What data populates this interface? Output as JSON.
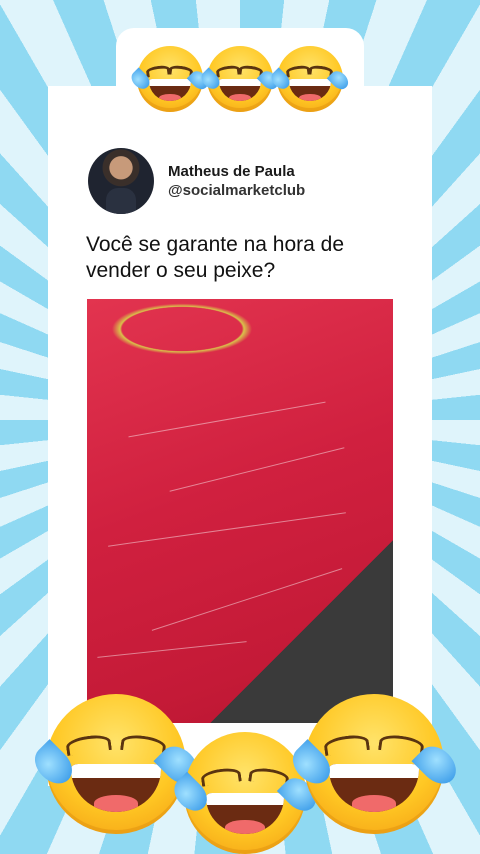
{
  "post": {
    "author_name": "Matheus de Paula",
    "author_handle": "@socialmarketclub",
    "text": "Você se garante na hora de vender o seu peixe?"
  },
  "decorations": {
    "top_emoji": "face-with-tears-of-joy",
    "bottom_emoji": "face-with-tears-of-joy"
  },
  "colors": {
    "background_ray_light": "#dff4fb",
    "background_ray_blue": "#8fd9f2",
    "card": "#ffffff",
    "media_red": "#d0203f"
  }
}
